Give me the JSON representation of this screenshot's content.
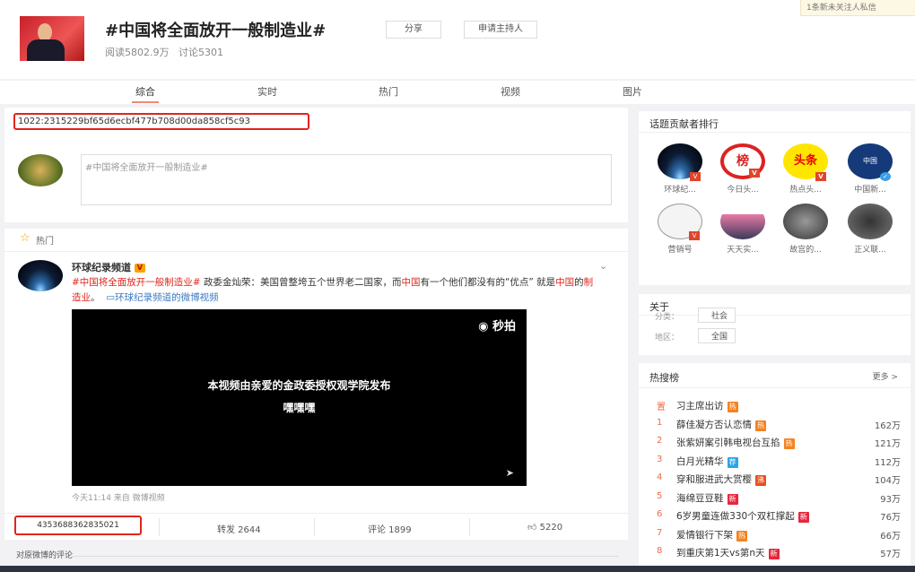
{
  "notice": "1条新未关注人私信",
  "topic": {
    "title": "#中国将全面放开一般制造业#",
    "reads": "阅读5802.9万",
    "discussions": "讨论5301",
    "share": "分享",
    "apply_host": "申请主持人"
  },
  "tabs": [
    "综合",
    "实时",
    "热门",
    "视频",
    "图片"
  ],
  "active_tab": "综合",
  "id_label": "1022:2315229bf65d6ecbf477b708d00da858cf5c93",
  "composer": {
    "value": "#中国将全面放开一般制造业#"
  },
  "hot_section": "热门",
  "post": {
    "author": "环球纪录频道",
    "text_hashtag": "#中国将全面放开一般制造业#",
    "text_1": " 政委金灿荣：美国曾整垮五个世界老二国家，而",
    "text_china": "中国",
    "text_2": "有一个他们都没有的“优点” 就是",
    "text_china2": "中国",
    "text_3": "的",
    "text_mfg": "制造业",
    "text_4": "。",
    "video_link": "环球纪录频道的微博视频",
    "video_logo": "秒拍",
    "video_caption_1": "本视频由亲爱的金政委授权观学院发布",
    "video_caption_2": "嘿嘿嘿",
    "meta": "今天11:14 来自 微博视频",
    "mid": "4353688362835021",
    "repost": "转发 2644",
    "comment": "评论 1899",
    "like": "5220"
  },
  "comments_header": "对原微博的评论",
  "contributors": {
    "title": "话题贡献者排行",
    "items": [
      "环球纪...",
      "今日头...",
      "热点头...",
      "中国新...",
      "营销号",
      "天天实...",
      "故宫的...",
      "正义联..."
    ]
  },
  "about": {
    "title": "关于",
    "category_label": "分类：",
    "category": "社会",
    "region_label": "地区：",
    "region": "全国"
  },
  "hot_search": {
    "title": "热搜榜",
    "more": "更多 >",
    "items": [
      {
        "rank": "置",
        "text": "习主席出访",
        "badge": "热",
        "badge_color": "#f5821f",
        "count": ""
      },
      {
        "rank": "1",
        "text": "薛佳凝方否认恋情",
        "badge": "热",
        "badge_color": "#f5821f",
        "count": "162万"
      },
      {
        "rank": "2",
        "text": "张紫妍案引韩电视台互掐",
        "badge": "热",
        "badge_color": "#f5821f",
        "count": "121万"
      },
      {
        "rank": "3",
        "text": "白月光精华",
        "badge": "荐",
        "badge_color": "#2aa4e8",
        "count": "112万"
      },
      {
        "rank": "4",
        "text": "穿和服进武大赏樱",
        "badge": "沸",
        "badge_color": "#e8501e",
        "count": "104万"
      },
      {
        "rank": "5",
        "text": "海绵豆豆鞋",
        "badge": "新",
        "badge_color": "#e8263c",
        "count": "93万"
      },
      {
        "rank": "6",
        "text": "6岁男童连做330个双杠撑起",
        "badge": "新",
        "badge_color": "#e8263c",
        "count": "76万"
      },
      {
        "rank": "7",
        "text": "爱情银行下架",
        "badge": "热",
        "badge_color": "#f5821f",
        "count": "66万"
      },
      {
        "rank": "8",
        "text": "到重庆第1天vs第n天",
        "badge": "新",
        "badge_color": "#e8263c",
        "count": "57万"
      }
    ]
  }
}
